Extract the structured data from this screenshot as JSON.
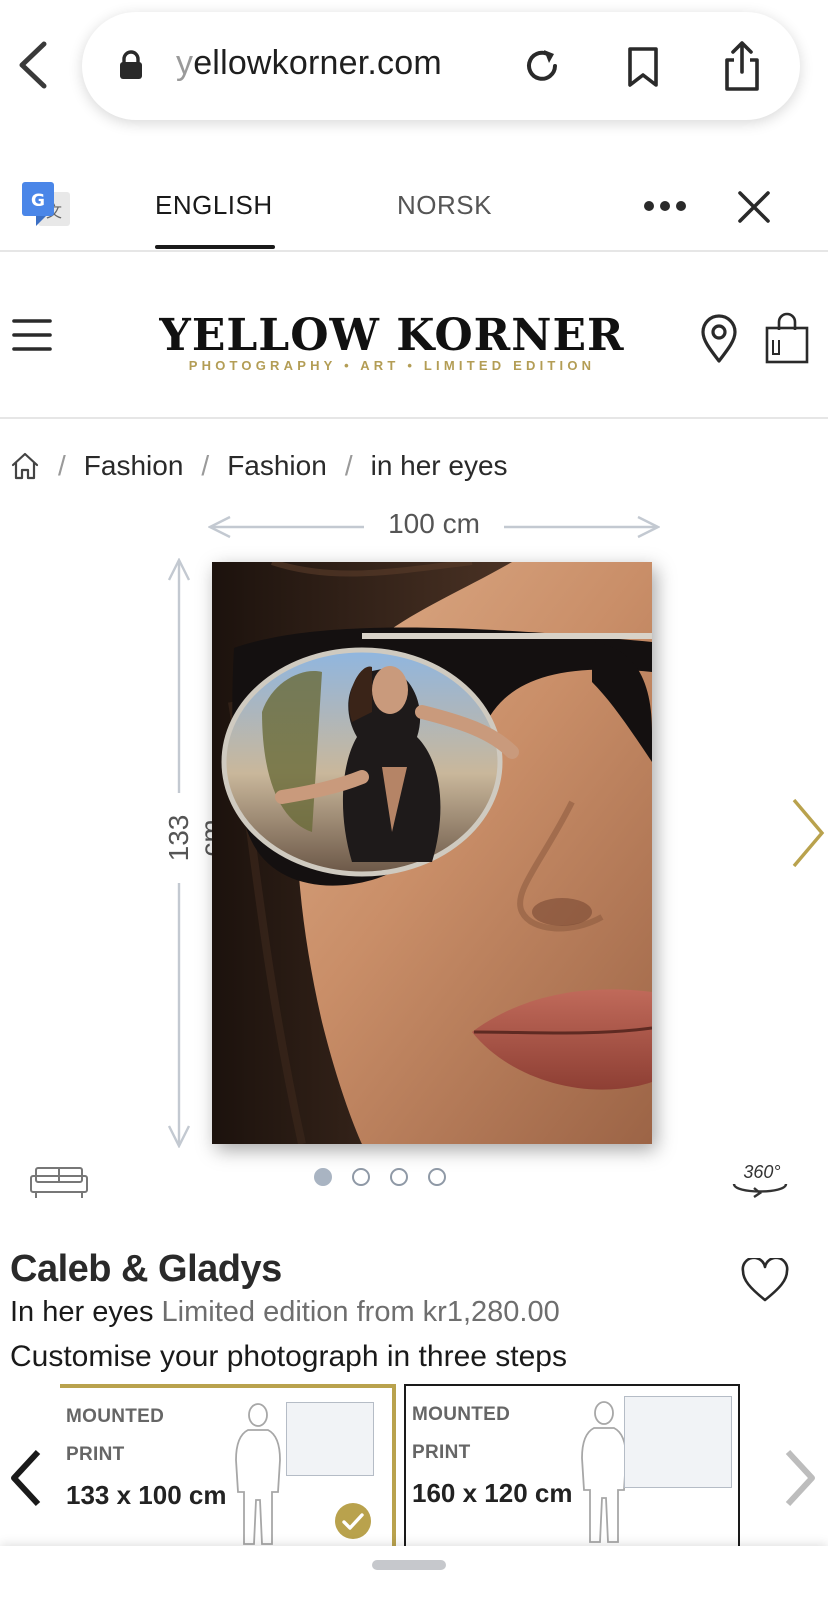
{
  "browser": {
    "url_prefix": "y",
    "url_main": "ellowkorner.com"
  },
  "translate": {
    "tabs": [
      "ENGLISH",
      "NORSK"
    ],
    "selected": "ENGLISH"
  },
  "site": {
    "logo_main": "YELLOW KORNER",
    "logo_sub": "PHOTOGRAPHY • ART • LIMITED EDITION",
    "brand_color": "#b39d55"
  },
  "breadcrumb": {
    "items": [
      "Fashion",
      "Fashion",
      "in her eyes"
    ],
    "separator": "/"
  },
  "image": {
    "width_label": "100 cm",
    "height_label": "133 cm",
    "gallery_total": 4,
    "gallery_active": 1,
    "view360_label": "360°"
  },
  "product": {
    "artist": "Caleb & Gladys",
    "title": "In her eyes",
    "edition_text": "Limited edition from kr1,280.00",
    "customise_text": "Customise your photograph in three steps"
  },
  "options": [
    {
      "line1": "MOUNTED",
      "line2": "PRINT",
      "size": "133 x 100 cm",
      "selected": true
    },
    {
      "line1": "MOUNTED",
      "line2": "PRINT",
      "size": "160 x 120 cm",
      "selected": false
    }
  ],
  "colors": {
    "accent_gold": "#b9a24d",
    "muted_text": "#6e6e6e"
  }
}
